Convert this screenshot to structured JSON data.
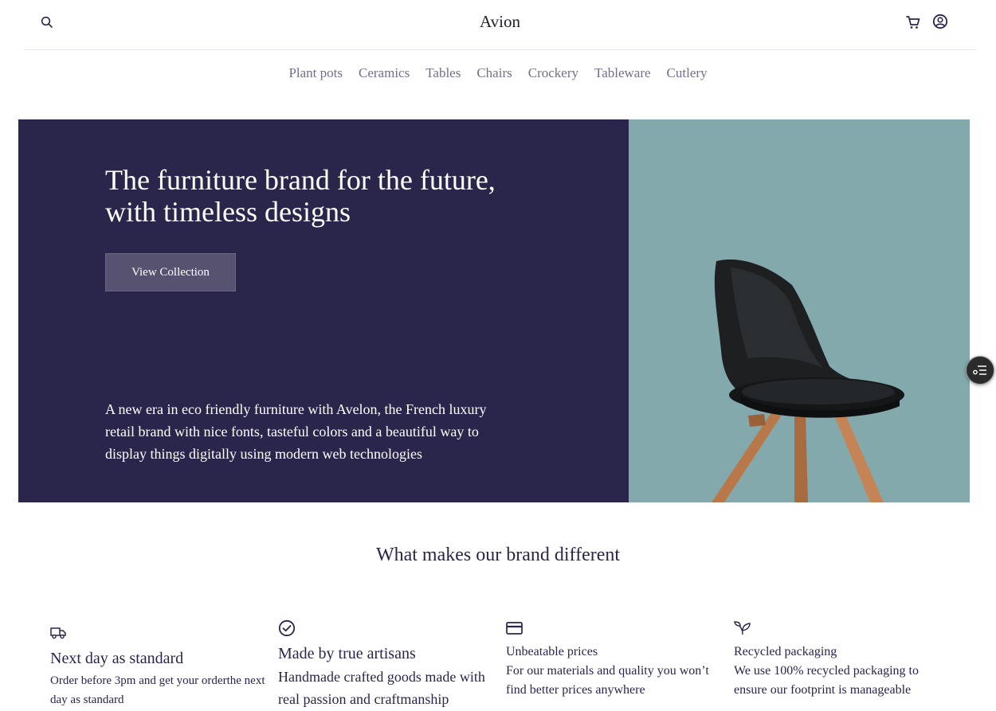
{
  "header": {
    "logo": "Avion",
    "icons": [
      "search-icon",
      "cart-icon",
      "user-icon"
    ]
  },
  "nav": {
    "categories": [
      "Plant pots",
      "Ceramics",
      "Tables",
      "Chairs",
      "Crockery",
      "Tableware",
      "Cutlery"
    ]
  },
  "hero": {
    "title": "The furniture brand for the future, with timeless designs",
    "button_label": "View Collection",
    "description": "A new era in eco friendly furniture with Avelon, the French luxury retail brand with nice fonts, tasteful colors and a beautiful way to display things digitally using modern web technologies"
  },
  "features": {
    "title": "What makes our brand different",
    "items": [
      {
        "icon": "delivery-truck-icon",
        "heading": "Next day as standard",
        "text": "Order before 3pm and get your orderthe next day as standard"
      },
      {
        "icon": "check-circle-icon",
        "heading": "Made by true artisans",
        "text": "Handmade crafted goods made with real passion and craftmanship"
      },
      {
        "icon": "credit-card-icon",
        "heading": "Unbeatable prices",
        "text": "For our materials and quality you won’t find better prices anywhere"
      },
      {
        "icon": "sprout-icon",
        "heading": "Recycled packaging",
        "text": "We use 100% recycled packaging to ensure our footprint is manageable"
      }
    ]
  },
  "colors": {
    "primary": "#2A254B",
    "hero_right": "#84A9AC",
    "button": "#56526F",
    "nav_text": "#726E8D"
  }
}
